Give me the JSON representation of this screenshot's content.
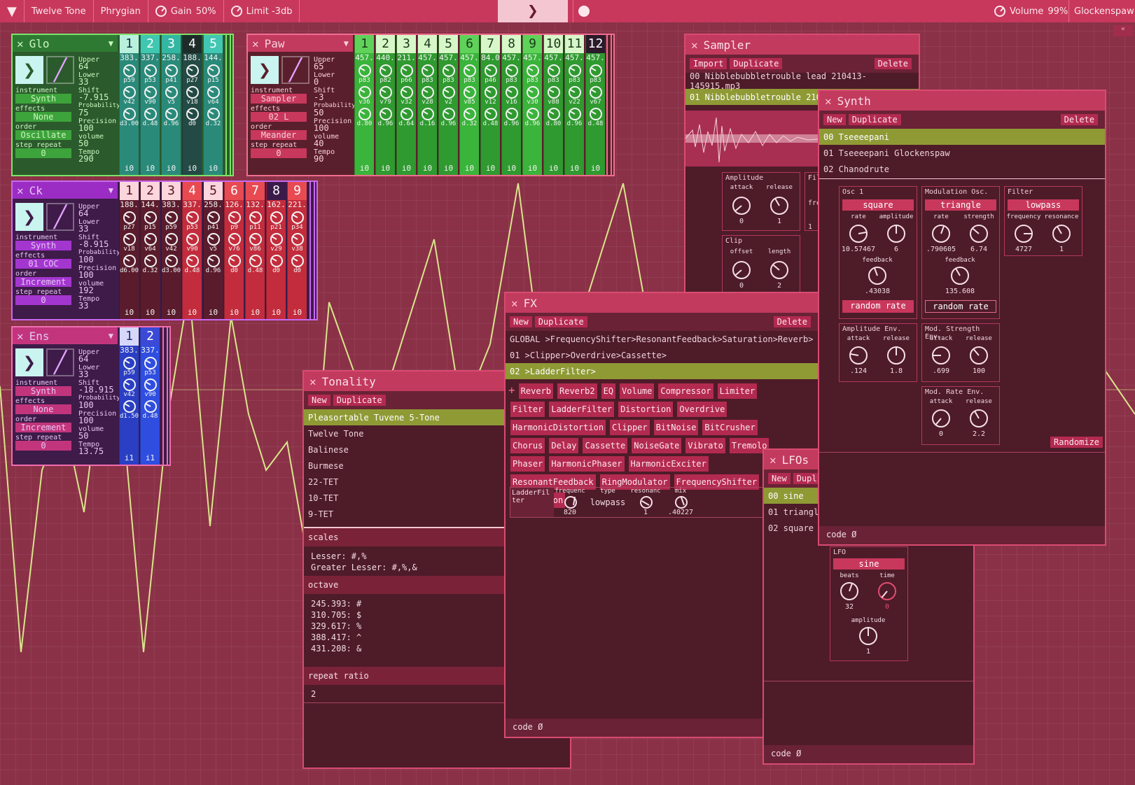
{
  "topbar": {
    "scale": "Twelve Tone",
    "mode": "Phrygian",
    "gain_label": "Gain",
    "gain": "50%",
    "limit": "Limit -3db",
    "volume_label": "Volume",
    "volume": "99%",
    "instrument": "Glockenspaw"
  },
  "glo": {
    "name": "Glo",
    "upper": "64",
    "lower": "33",
    "shift": "-7.915",
    "probability": "75",
    "precision": "100",
    "volume": "50",
    "tempo": "290",
    "instrument": "Synth",
    "effects": "None",
    "order": "Oscillate",
    "step_repeat": "0",
    "cols": [
      {
        "n": "1",
        "v": "383.",
        "p": "p59",
        "vv": "v42",
        "d": "d3.00"
      },
      {
        "n": "2",
        "v": "337.",
        "p": "p53",
        "vv": "v90",
        "d": "d.48"
      },
      {
        "n": "3",
        "v": "258.",
        "p": "p41",
        "vv": "v5",
        "d": "d.96"
      },
      {
        "n": "4",
        "v": "188.",
        "p": "p27",
        "vv": "v18",
        "d": "d0"
      },
      {
        "n": "5",
        "v": "144.",
        "p": "p15",
        "vv": "v64",
        "d": "d.32"
      }
    ]
  },
  "paw": {
    "name": "Paw",
    "upper": "65",
    "lower": "0",
    "shift": "-3",
    "probability": "50",
    "precision": "100",
    "volume": "40",
    "tempo": "90",
    "instrument": "Sampler",
    "effects": "02 L",
    "order": "Meander",
    "step_repeat": "0",
    "cols": [
      {
        "n": "1",
        "v": "457.",
        "p": "p83",
        "vv": "v36",
        "d": "d.80"
      },
      {
        "n": "2",
        "v": "440.",
        "p": "p82",
        "vv": "v79",
        "d": "d.96"
      },
      {
        "n": "3",
        "v": "211.",
        "p": "p66",
        "vv": "v32",
        "d": "d.64"
      },
      {
        "n": "4",
        "v": "457.",
        "p": "p83",
        "vv": "v28",
        "d": "d.16"
      },
      {
        "n": "5",
        "v": "457.",
        "p": "p83",
        "vv": "v2",
        "d": "d.96"
      },
      {
        "n": "6",
        "v": "457.",
        "p": "p83",
        "vv": "v85",
        "d": "d.32"
      },
      {
        "n": "7",
        "v": "84.0",
        "p": "p46",
        "vv": "v12",
        "d": "d.48"
      },
      {
        "n": "8",
        "v": "457.",
        "p": "p83",
        "vv": "v16",
        "d": "d.96"
      },
      {
        "n": "9",
        "v": "457.",
        "p": "p83",
        "vv": "v30",
        "d": "d.96"
      },
      {
        "n": "10",
        "v": "457.",
        "p": "p83",
        "vv": "v88",
        "d": "d.80"
      },
      {
        "n": "11",
        "v": "457.",
        "p": "p83",
        "vv": "v22",
        "d": "d.96"
      },
      {
        "n": "12",
        "v": "457.",
        "p": "p83",
        "vv": "v67",
        "d": "d.48"
      }
    ]
  },
  "ck": {
    "name": "Ck",
    "upper": "64",
    "lower": "33",
    "shift": "-8.915",
    "probability": "100",
    "precision": "100",
    "volume": "192",
    "tempo": "33",
    "instrument": "Synth",
    "effects": "01 COC",
    "order": "Increment",
    "step_repeat": "0",
    "cols": [
      {
        "n": "1",
        "v": "188.",
        "p": "p27",
        "vv": "v18",
        "d": "d6.00"
      },
      {
        "n": "2",
        "v": "144.",
        "p": "p15",
        "vv": "v64",
        "d": "d.32"
      },
      {
        "n": "3",
        "v": "383.",
        "p": "p59",
        "vv": "v42",
        "d": "d3.00"
      },
      {
        "n": "4",
        "v": "337.",
        "p": "p53",
        "vv": "v90",
        "d": "d.48"
      },
      {
        "n": "5",
        "v": "258.",
        "p": "p41",
        "vv": "v5",
        "d": "d.96"
      },
      {
        "n": "6",
        "v": "126.",
        "p": "p9",
        "vv": "v76",
        "d": "d0"
      },
      {
        "n": "7",
        "v": "132.",
        "p": "p11",
        "vv": "v86",
        "d": "d.48"
      },
      {
        "n": "8",
        "v": "162.",
        "p": "p21",
        "vv": "v29",
        "d": "d0"
      },
      {
        "n": "9",
        "v": "221.",
        "p": "p34",
        "vv": "v38",
        "d": "d0"
      }
    ]
  },
  "ens": {
    "name": "Ens",
    "upper": "64",
    "lower": "33",
    "shift": "-18.915",
    "probability": "100",
    "precision": "100",
    "volume": "50",
    "tempo": "13.75",
    "instrument": "Synth",
    "effects": "None",
    "order": "Increment",
    "step_repeat": "0",
    "cols": [
      {
        "n": "1",
        "v": "383.",
        "p": "p59",
        "vv": "v42",
        "d": "d1.50",
        "i": "i1"
      },
      {
        "n": "2",
        "v": "337.",
        "p": "p53",
        "vv": "v90",
        "d": "d.48",
        "i": "i1"
      }
    ]
  },
  "labels": {
    "upper": "Upper",
    "lower": "Lower",
    "shift": "Shift",
    "probability": "Probability",
    "precision": "Precision",
    "volume": "volume",
    "tempo": "Tempo",
    "instrument": "instrument",
    "effects": "effects",
    "order": "order",
    "step_repeat": "step repeat",
    "i0": "i0"
  },
  "sampler": {
    "title": "Sampler",
    "import": "Import",
    "duplicate": "Duplicate",
    "delete": "Delete",
    "items": [
      "00 Nibblebubbletrouble lead 210413-145915.mp3",
      "01 Nibblebubbletrouble 210"
    ],
    "amplitude": "Amplitude",
    "attack": "attack",
    "release": "release",
    "amp_attack": "0",
    "amp_release": "1",
    "clip": "Clip",
    "offset": "offset",
    "length": "length",
    "clip_offset": "0",
    "clip_length": "2",
    "fil": "Fil",
    "fre": "fre",
    "fre_val": "1"
  },
  "synth": {
    "title": "Synth",
    "new": "New",
    "duplicate": "Duplicate",
    "delete": "Delete",
    "items": [
      "00 Tseeeepani",
      "01 Tseeeepani Glockenspaw",
      "02 Chanodrute"
    ],
    "osc1": {
      "title": "Osc 1",
      "wave": "square",
      "rate_l": "rate",
      "amp_l": "amplitude",
      "rate": "10.57467",
      "amp": "6",
      "fb_l": "feedback",
      "fb": ".43038",
      "random": "random rate"
    },
    "mod": {
      "title": "Modulation Osc.",
      "wave": "triangle",
      "rate_l": "rate",
      "str_l": "strength",
      "rate": ".790605",
      "str": "6.74",
      "fb_l": "feedback",
      "fb": "135.608",
      "random": "random rate"
    },
    "filter": {
      "title": "Filter",
      "type": "lowpass",
      "freq_l": "frequency",
      "res_l": "resonance",
      "freq": "4727",
      "res": "1"
    },
    "ampenv": {
      "title": "Amplitude Env.",
      "attack": ".124",
      "release": "1.8"
    },
    "strenv": {
      "title": "Mod. Strength Env.",
      "attack": ".699",
      "release": "100"
    },
    "rateenv": {
      "title": "Mod. Rate Env.",
      "attack": "0",
      "release": "2.2"
    },
    "attack_l": "attack",
    "release_l": "release",
    "randomize": "Randomize",
    "code": "code Ø"
  },
  "fx": {
    "title": "FX",
    "new": "New",
    "duplicate": "Duplicate",
    "delete": "Delete",
    "items": [
      "GLOBAL >FrequencyShifter>ResonantFeedback>Saturation>Reverb>",
      "01 >Clipper>Overdrive>Cassette>",
      "02 >LadderFilter>"
    ],
    "add": "+",
    "effects": [
      "Reverb",
      "Reverb2",
      "EQ",
      "Volume",
      "Compressor",
      "Limiter",
      "Filter",
      "LadderFilter",
      "Distortion",
      "Overdrive",
      "HarmonicDistortion",
      "Clipper",
      "BitNoise",
      "BitCrusher",
      "Chorus",
      "Delay",
      "Cassette",
      "NoiseGate",
      "Vibrato",
      "Tremolo",
      "Phaser",
      "HarmonicPhaser",
      "HarmonicExciter",
      "ResonantFeedback",
      "RingModulator",
      "FrequencyShifter",
      "Saturation"
    ],
    "ladder": {
      "name": "LadderFilter",
      "freq_l": "frequenc",
      "freq": "820",
      "type_l": "type",
      "type": "lowpass",
      "res_l": "resonanc",
      "res": "1",
      "mix_l": "mix",
      "mix": ".40227"
    },
    "code": "code Ø"
  },
  "tonality": {
    "title": "Tonality",
    "new": "New",
    "duplicate": "Duplicate",
    "items": [
      "Pleasortable Tuvene 5-Tone",
      "Twelve Tone",
      "Balinese",
      "Burmese",
      "22-TET",
      "10-TET",
      "9-TET"
    ],
    "scales_h": "scales",
    "scales": [
      "Lesser: #,%",
      "Greater Lesser: #,%,&"
    ],
    "octave_h": "octave",
    "octave": [
      "245.393: #",
      "310.705: $",
      "329.617: %",
      "388.417: ^",
      "431.208: &"
    ],
    "repeat_h": "repeat ratio",
    "repeat": "2"
  },
  "lfos": {
    "title": "LFOs",
    "new": "New",
    "duplicate": "Dupli",
    "items": [
      "00 sine",
      "01 triangl",
      "02 square"
    ],
    "lfo_l": "LFO",
    "wave": "sine",
    "beats_l": "beats",
    "time_l": "time",
    "beats": "32",
    "time": "0",
    "amp_l": "amplitude",
    "amp": "1",
    "code": "code Ø"
  }
}
